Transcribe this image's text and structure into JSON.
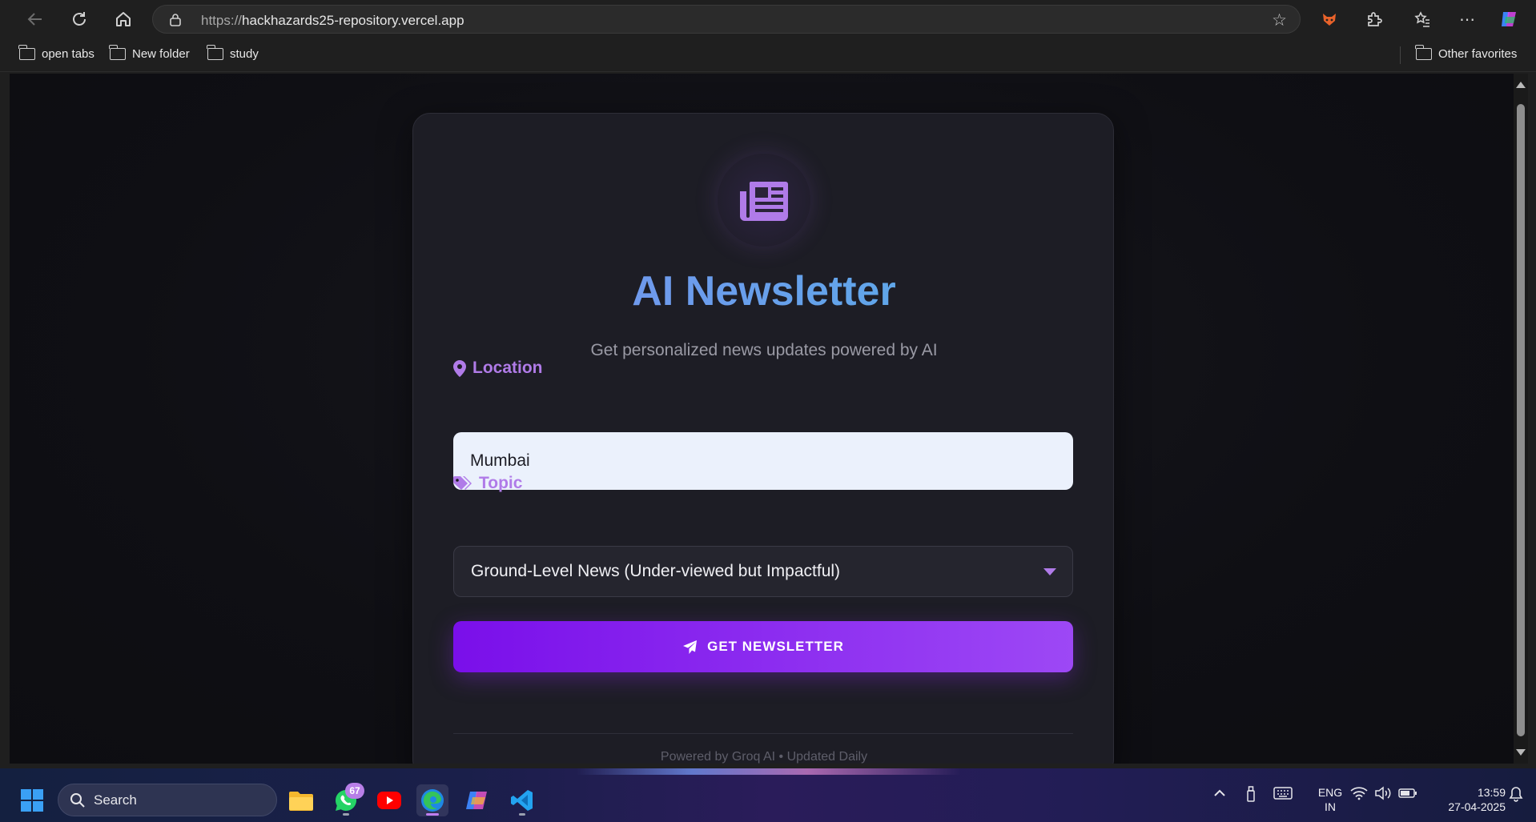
{
  "browser": {
    "url_scheme": "https://",
    "url_host": "hackhazards25-repository.vercel.app",
    "bookmarks": [
      {
        "label": "open tabs"
      },
      {
        "label": "New folder"
      },
      {
        "label": "study"
      }
    ],
    "other_favorites": "Other favorites"
  },
  "app": {
    "title": "AI Newsletter",
    "subtitle": "Get personalized news updates powered by AI",
    "location_label": "Location",
    "location_value": "Mumbai",
    "topic_label": "Topic",
    "topic_value": "Ground-Level News (Under-viewed but Impactful)",
    "cta_label": "GET NEWSLETTER",
    "footer": "Powered by Groq AI • Updated Daily",
    "colors": {
      "accent": "#b07be8",
      "button_start": "#7a0fea",
      "button_end": "#9d48f5",
      "title_start": "#7c8ff0",
      "title_end": "#53b0e6"
    }
  },
  "taskbar": {
    "search_placeholder": "Search",
    "whatsapp_badge": "67",
    "lang_line1": "ENG",
    "lang_line2": "IN",
    "time": "13:59",
    "date": "27-04-2025"
  }
}
